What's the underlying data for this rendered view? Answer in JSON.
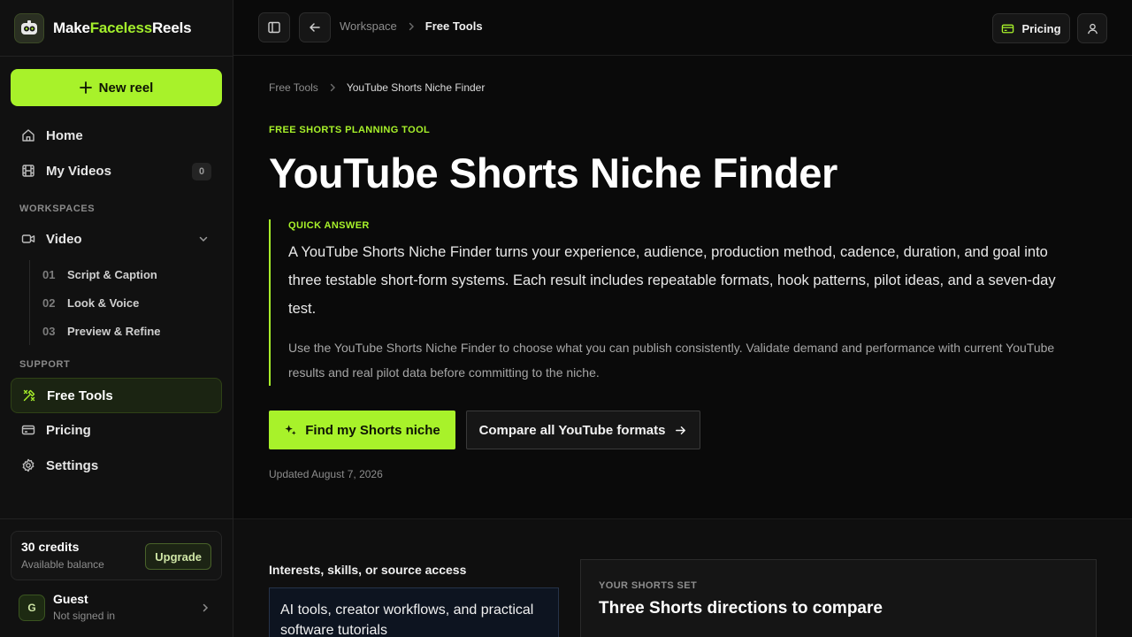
{
  "brand": {
    "prefix": "Make",
    "accent": "Faceless",
    "suffix": "Reels",
    "accent_color": "#a8f22a"
  },
  "sidebar": {
    "new_reel_label": "New reel",
    "nav": [
      {
        "label": "Home",
        "icon": "home-icon"
      },
      {
        "label": "My Videos",
        "icon": "film-icon",
        "count": "0"
      }
    ],
    "workspaces_label": "WORKSPACES",
    "workspace": {
      "label": "Video",
      "icon": "video-icon"
    },
    "workspace_steps": [
      {
        "num": "01",
        "label": "Script & Caption"
      },
      {
        "num": "02",
        "label": "Look & Voice"
      },
      {
        "num": "03",
        "label": "Preview & Refine"
      }
    ],
    "support_label": "SUPPORT",
    "support": [
      {
        "label": "Free Tools",
        "icon": "tools-icon",
        "active": true
      },
      {
        "label": "Pricing",
        "icon": "card-icon"
      },
      {
        "label": "Settings",
        "icon": "gear-icon"
      }
    ],
    "credits": {
      "title": "30 credits",
      "subtitle": "Available balance",
      "upgrade_label": "Upgrade"
    },
    "user": {
      "initial": "G",
      "name": "Guest",
      "status": "Not signed in"
    }
  },
  "topbar": {
    "breadcrumb": [
      "Workspace",
      "Free Tools"
    ],
    "pricing_label": "Pricing"
  },
  "main": {
    "breadcrumb": [
      "Free Tools",
      "YouTube Shorts Niche Finder"
    ],
    "eyebrow": "FREE SHORTS PLANNING TOOL",
    "title": "YouTube Shorts Niche Finder",
    "quick_answer_label": "QUICK ANSWER",
    "quick_answer": "A YouTube Shorts Niche Finder turns your experience, audience, production method, cadence, duration, and goal into three testable short-form systems. Each result includes repeatable formats, hook patterns, pilot ideas, and a seven-day test.",
    "quick_note": "Use the YouTube Shorts Niche Finder to choose what you can publish consistently. Validate demand and performance with current YouTube results and real pilot data before committing to the niche.",
    "primary_cta": "Find my Shorts niche",
    "secondary_cta": "Compare all YouTube formats",
    "updated": "Updated August 7, 2026"
  },
  "form": {
    "interests_label": "Interests, skills, or source access",
    "interests_value": "AI tools, creator workflows, and practical software tutorials"
  },
  "results": {
    "eyebrow": "YOUR SHORTS SET",
    "title": "Three Shorts directions to compare"
  }
}
